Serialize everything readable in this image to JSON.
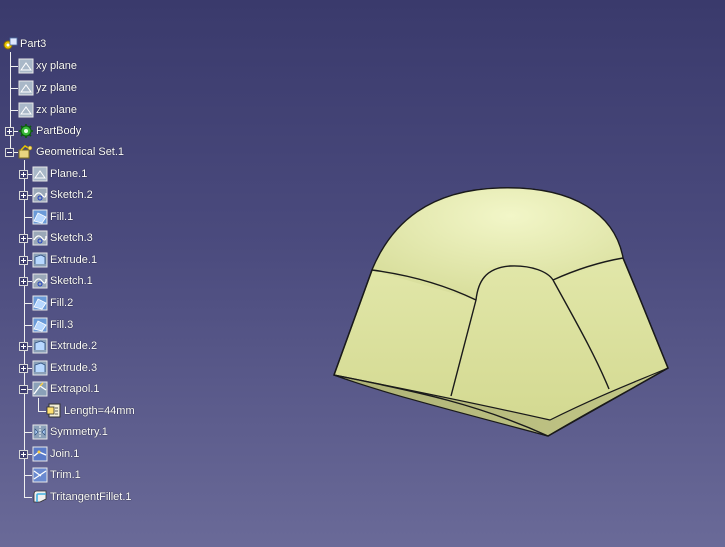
{
  "tree": {
    "root": {
      "label": "Part3",
      "icon": "part-icon"
    },
    "items": [
      {
        "label": "xy plane",
        "icon": "plane-icon"
      },
      {
        "label": "yz plane",
        "icon": "plane-icon"
      },
      {
        "label": "zx plane",
        "icon": "plane-icon"
      },
      {
        "label": "PartBody",
        "icon": "body-gear-icon"
      },
      {
        "label": "Geometrical Set.1",
        "icon": "geometrical-set-icon"
      },
      {
        "label": "Plane.1",
        "icon": "plane-icon"
      },
      {
        "label": "Sketch.2",
        "icon": "sketch-icon"
      },
      {
        "label": "Fill.1",
        "icon": "fill-icon"
      },
      {
        "label": "Sketch.3",
        "icon": "sketch-icon"
      },
      {
        "label": "Extrude.1",
        "icon": "extrude-icon"
      },
      {
        "label": "Sketch.1",
        "icon": "sketch-icon"
      },
      {
        "label": "Fill.2",
        "icon": "fill-icon"
      },
      {
        "label": "Fill.3",
        "icon": "fill-icon"
      },
      {
        "label": "Extrude.2",
        "icon": "extrude-icon"
      },
      {
        "label": "Extrude.3",
        "icon": "extrude-icon"
      },
      {
        "label": "Extrapol.1",
        "icon": "extrapolate-icon"
      },
      {
        "label": "Length=44mm",
        "icon": "parameter-icon"
      },
      {
        "label": "Symmetry.1",
        "icon": "symmetry-icon"
      },
      {
        "label": "Join.1",
        "icon": "join-icon"
      },
      {
        "label": "Trim.1",
        "icon": "trim-icon"
      },
      {
        "label": "TritangentFillet.1",
        "icon": "fillet-icon"
      }
    ]
  },
  "colors": {
    "background_top": "#3a3a6c",
    "background_bottom": "#6a6a98",
    "surface": "#e2e7aa",
    "surface_dark": "#c0c583",
    "edge": "#1a1a1a"
  }
}
